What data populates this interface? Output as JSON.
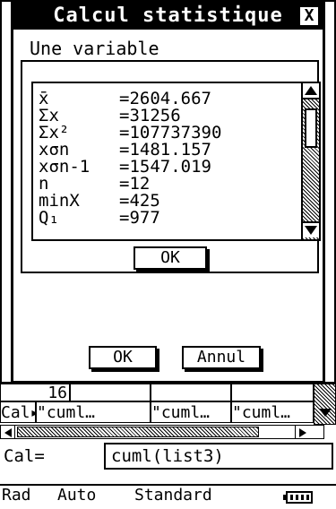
{
  "dialog": {
    "title": "Calcul statistique",
    "close_label": "X",
    "subtitle": "Une variable",
    "stats": [
      {
        "label": "x̄",
        "value": "=2604.667"
      },
      {
        "label": "Σx",
        "value": "=31256"
      },
      {
        "label": "Σx²",
        "value": "=107737390"
      },
      {
        "label": "xσn",
        "value": "=1481.157"
      },
      {
        "label": "xσn-1",
        "value": "=1547.019"
      },
      {
        "label": "n",
        "value": "=12"
      },
      {
        "label": "minX",
        "value": "=425"
      },
      {
        "label": "Q₁",
        "value": "=977"
      }
    ],
    "ok_inner_label": "OK",
    "ok_label": "OK",
    "cancel_label": "Annul"
  },
  "sheet": {
    "row_number": "16",
    "row_header": "Cal▸",
    "cells": [
      "\"cuml…",
      "\"cuml…",
      "\"cuml…"
    ],
    "cal_label": "Cal=",
    "cal_value": "cuml(list3)"
  },
  "status": {
    "angle": "Rad",
    "mode": "Auto",
    "format": "Standard",
    "battery_icon": "battery-icon"
  }
}
